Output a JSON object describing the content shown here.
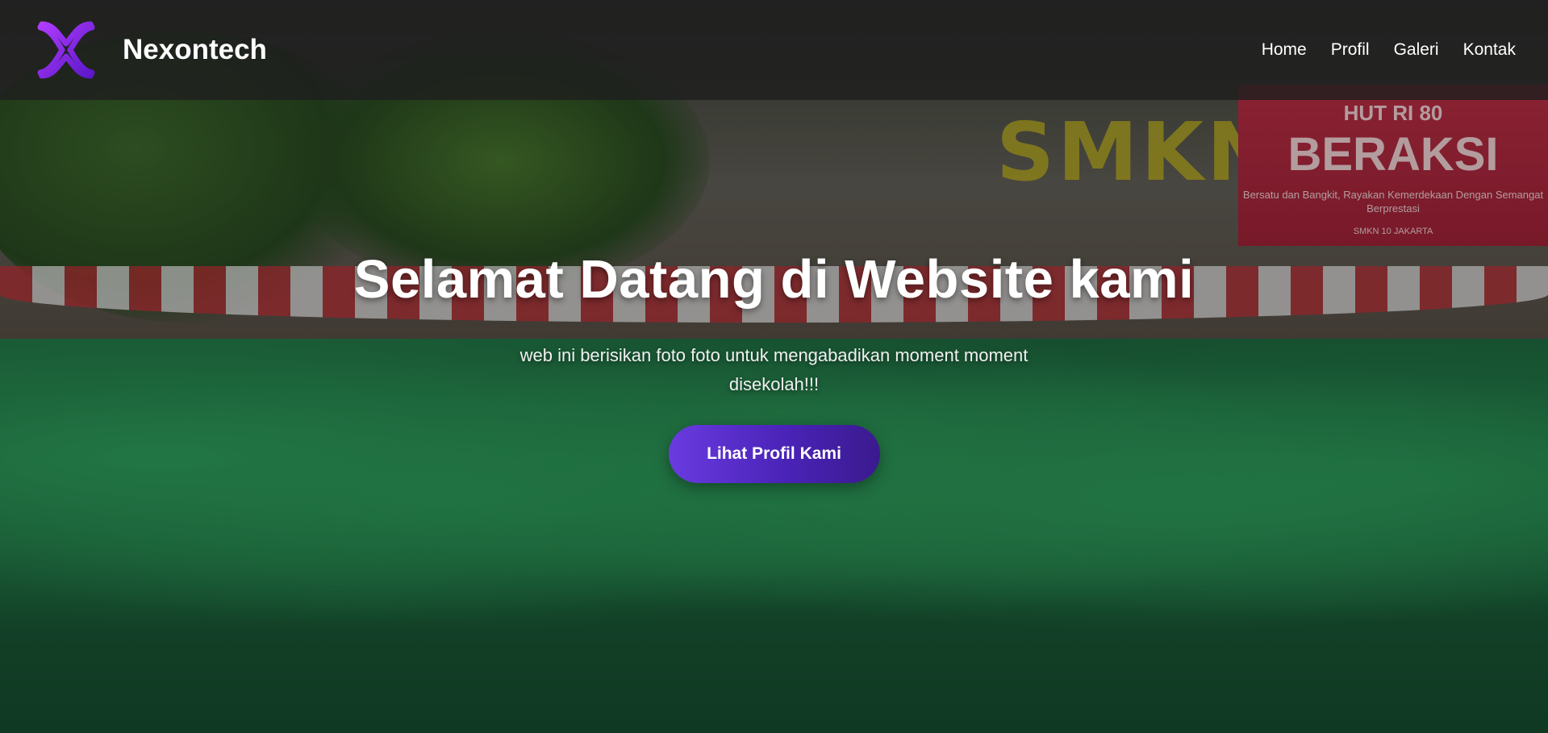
{
  "nav": {
    "brand": "Nexontech",
    "logo_icon": "x-logo-icon",
    "logo_colors": [
      "#a12cff",
      "#5b17c8"
    ],
    "links": [
      {
        "label": "Home"
      },
      {
        "label": "Profil"
      },
      {
        "label": "Galeri"
      },
      {
        "label": "Kontak"
      }
    ]
  },
  "background": {
    "sign": "SMKN",
    "banner": {
      "line1": "HUT RI 80",
      "line2": "BERAKSI",
      "line3": "Bersatu dan Bangkit, Rayakan Kemerdekaan Dengan Semangat Berprestasi",
      "line4": "SMKN 10 JAKARTA"
    }
  },
  "hero": {
    "title": "Selamat Datang di Website kami",
    "subtitle": "web ini berisikan foto foto untuk mengabadikan moment moment disekolah!!!",
    "cta_label": "Lihat Profil Kami",
    "cta_colors": [
      "#6a3be0",
      "#3a1a8e"
    ]
  }
}
